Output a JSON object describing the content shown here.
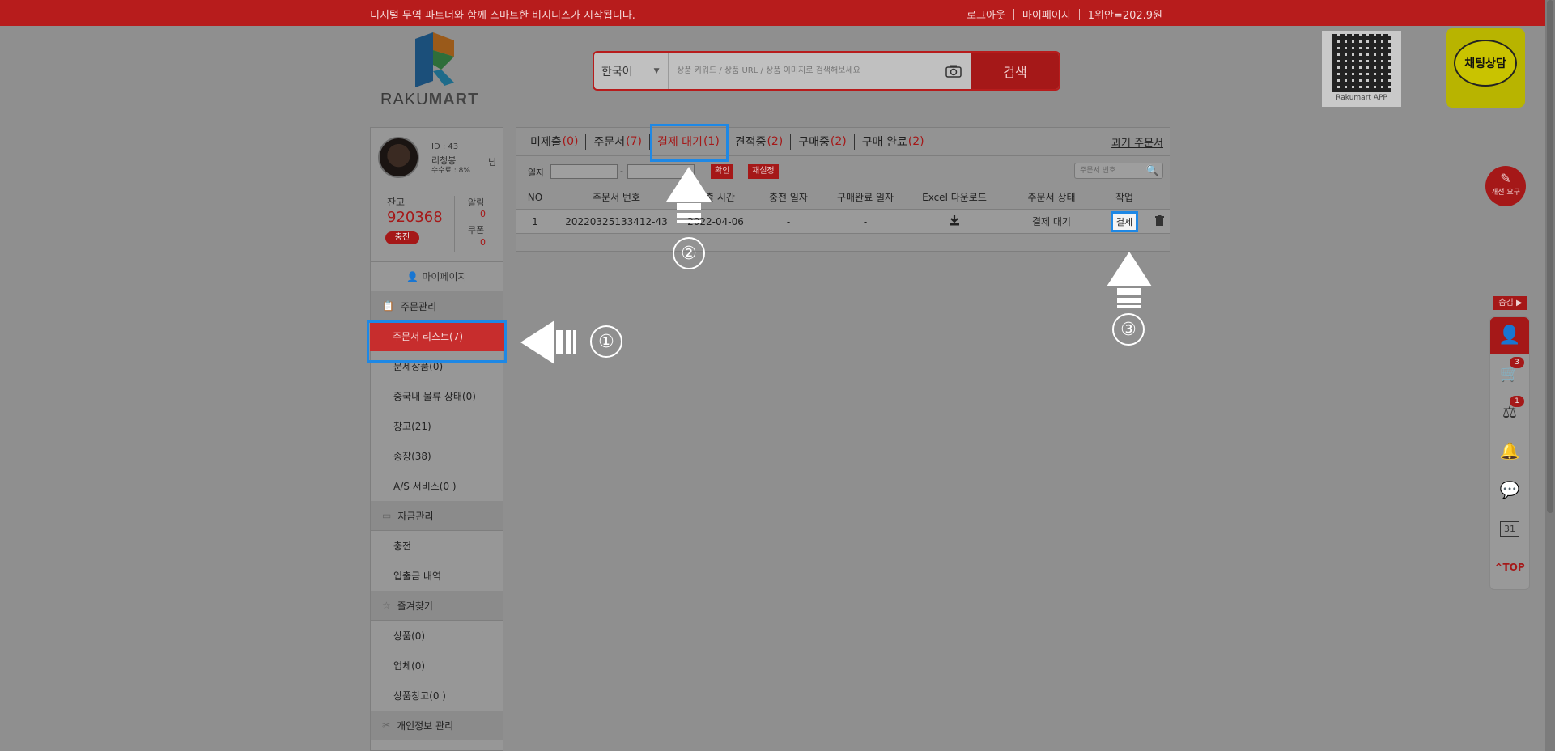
{
  "topbar": {
    "slogan": "디지털 무역 파트너와 함께 스마트한 비지니스가 시작됩니다.",
    "logout": "로그아웃",
    "mypage": "마이페이지",
    "rate": "1위안=202.9원"
  },
  "logo": {
    "text_a": "RAKU",
    "text_b": "MART"
  },
  "search": {
    "language": "한국어",
    "placeholder": "상품 키워드 / 상품 URL / 상품 이미지로 검색해보세요",
    "button": "검색"
  },
  "qr": {
    "caption": "Rakumart APP"
  },
  "chat": {
    "label": "채팅상담"
  },
  "profile": {
    "id": "ID : 43",
    "name": "리청봉",
    "suffix": "님",
    "fee": "수수료 : 8%",
    "balance_label": "잔고",
    "balance": "920368",
    "charge": "충전",
    "alarm_label": "알림",
    "alarm_value": "0",
    "coupon_label": "쿠폰",
    "coupon_value": "0"
  },
  "sidebar": {
    "mypage": "마이페이지",
    "order_group": "주문관리",
    "order_items": [
      "주문서 리스트(7)",
      "문제상품(0)",
      "중국내 물류 상태(0)",
      "창고(21)",
      "송장(38)",
      "A/S 서비스(0 )"
    ],
    "fund_group": "자금관리",
    "fund_items": [
      "충전",
      "입출금 내역"
    ],
    "fav_group": "즐겨찾기",
    "fav_items": [
      "상품(0)",
      "업체(0)",
      "상품창고(0 )"
    ],
    "info_group": "개인정보 관리"
  },
  "tabs": [
    {
      "label": "미제출",
      "count": "(0)"
    },
    {
      "label": "주문서",
      "count": "(7)"
    },
    {
      "label": "결제 대기",
      "count": "(1)"
    },
    {
      "label": "견적중",
      "count": "(2)"
    },
    {
      "label": "구매중",
      "count": "(2)"
    },
    {
      "label": "구매 완료",
      "count": "(2)"
    }
  ],
  "past_orders": "과거 주문서",
  "filter": {
    "date_label": "일자",
    "dash": "-",
    "confirm": "확인",
    "reset": "재설정",
    "order_no_placeholder": "주문서 번호"
  },
  "table": {
    "headers": [
      "NO",
      "주문서 번호",
      "제출 시간",
      "충전 일자",
      "구매완료 일자",
      "Excel 다운로드",
      "주문서 상태",
      "작업"
    ],
    "rows": [
      {
        "no": "1",
        "order_no": "20220325133412-43",
        "submitted": "2022-04-06",
        "charge_date": "-",
        "done_date": "-",
        "status": "결제 대기",
        "action": "결제"
      }
    ]
  },
  "steps": [
    "①",
    "②",
    "③"
  ],
  "rail": {
    "feedback": "개선 요구",
    "hide": "숨김 ▶",
    "cart_count": "3",
    "fav_count": "1",
    "calendar": "31",
    "top": "TOP"
  },
  "colors": {
    "brand_red": "#b71c1c",
    "highlight_blue": "#1e88e5"
  }
}
